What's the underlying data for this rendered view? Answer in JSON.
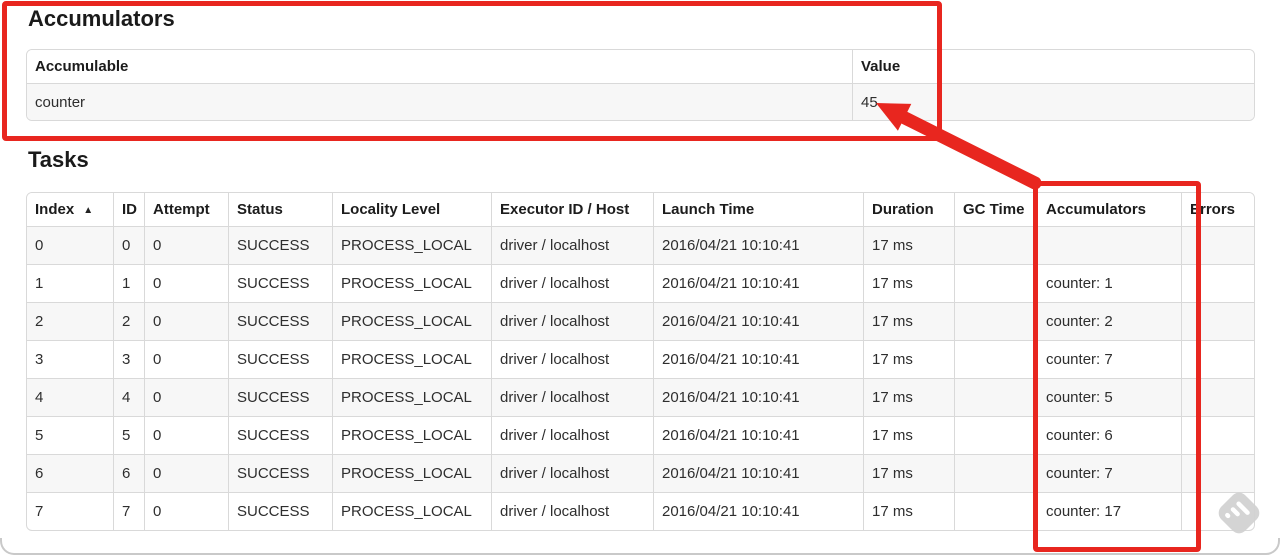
{
  "accumulators_section": {
    "title": "Accumulators",
    "columns": [
      "Accumulable",
      "Value"
    ],
    "rows": [
      [
        "counter",
        "45"
      ]
    ]
  },
  "tasks_section": {
    "title": "Tasks",
    "columns": [
      "Index",
      "ID",
      "Attempt",
      "Status",
      "Locality Level",
      "Executor ID / Host",
      "Launch Time",
      "Duration",
      "GC Time",
      "Accumulators",
      "Errors"
    ],
    "sort_indicator": "▲",
    "rows": [
      [
        "0",
        "0",
        "0",
        "SUCCESS",
        "PROCESS_LOCAL",
        "driver / localhost",
        "2016/04/21 10:10:41",
        "17 ms",
        "",
        "",
        ""
      ],
      [
        "1",
        "1",
        "0",
        "SUCCESS",
        "PROCESS_LOCAL",
        "driver / localhost",
        "2016/04/21 10:10:41",
        "17 ms",
        "",
        "counter: 1",
        ""
      ],
      [
        "2",
        "2",
        "0",
        "SUCCESS",
        "PROCESS_LOCAL",
        "driver / localhost",
        "2016/04/21 10:10:41",
        "17 ms",
        "",
        "counter: 2",
        ""
      ],
      [
        "3",
        "3",
        "0",
        "SUCCESS",
        "PROCESS_LOCAL",
        "driver / localhost",
        "2016/04/21 10:10:41",
        "17 ms",
        "",
        "counter: 7",
        ""
      ],
      [
        "4",
        "4",
        "0",
        "SUCCESS",
        "PROCESS_LOCAL",
        "driver / localhost",
        "2016/04/21 10:10:41",
        "17 ms",
        "",
        "counter: 5",
        ""
      ],
      [
        "5",
        "5",
        "0",
        "SUCCESS",
        "PROCESS_LOCAL",
        "driver / localhost",
        "2016/04/21 10:10:41",
        "17 ms",
        "",
        "counter: 6",
        ""
      ],
      [
        "6",
        "6",
        "0",
        "SUCCESS",
        "PROCESS_LOCAL",
        "driver / localhost",
        "2016/04/21 10:10:41",
        "17 ms",
        "",
        "counter: 7",
        ""
      ],
      [
        "7",
        "7",
        "0",
        "SUCCESS",
        "PROCESS_LOCAL",
        "driver / localhost",
        "2016/04/21 10:10:41",
        "17 ms",
        "",
        "counter: 17",
        ""
      ]
    ]
  },
  "annotations": {
    "highlight_color": "#e8261f"
  },
  "watermark": {
    "color": "#d2d2d2"
  }
}
